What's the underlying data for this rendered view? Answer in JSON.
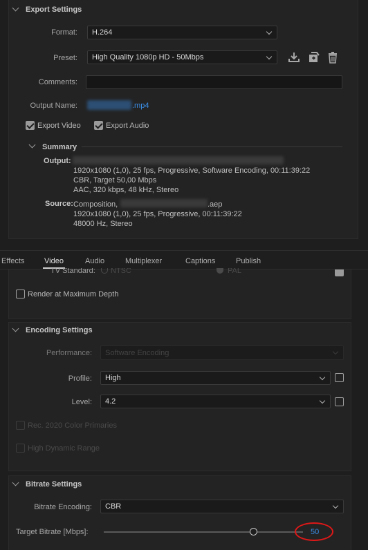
{
  "export_settings": {
    "title": "Export Settings",
    "format_label": "Format:",
    "format_value": "H.264",
    "preset_label": "Preset:",
    "preset_value": "High Quality 1080p HD - 50Mbps",
    "comments_label": "Comments:",
    "comments_value": "",
    "output_name_label": "Output Name:",
    "output_name_suffix": ".mp4",
    "export_video_label": "Export Video",
    "export_video_checked": true,
    "export_audio_label": "Export Audio",
    "export_audio_checked": true
  },
  "summary": {
    "title": "Summary",
    "output_label": "Output:",
    "output_lines": [
      "1920x1080 (1,0), 25 fps, Progressive, Software Encoding, 00:11:39:22",
      "CBR, Target 50,00 Mbps",
      "AAC, 320 kbps, 48 kHz, Stereo"
    ],
    "source_label": "Source:",
    "source_prefix": "Composition,",
    "source_suffix": ".aep",
    "source_lines": [
      "1920x1080 (1,0), 25 fps, Progressive, 00:11:39:22",
      "48000 Hz, Stereo"
    ]
  },
  "tabs": [
    "Effects",
    "Video",
    "Audio",
    "Multiplexer",
    "Captions",
    "Publish"
  ],
  "active_tab": "Video",
  "video": {
    "tv_standard_label": "TV Standard:",
    "ntsc_label": "NTSC",
    "pal_label": "PAL",
    "render_max_depth_label": "Render at Maximum Depth"
  },
  "encoding": {
    "title": "Encoding Settings",
    "performance_label": "Performance:",
    "performance_value": "Software Encoding",
    "profile_label": "Profile:",
    "profile_value": "High",
    "level_label": "Level:",
    "level_value": "4.2",
    "rec2020_label": "Rec. 2020 Color Primaries",
    "hdr_label": "High Dynamic Range"
  },
  "bitrate": {
    "title": "Bitrate Settings",
    "encoding_label": "Bitrate Encoding:",
    "encoding_value": "CBR",
    "target_label": "Target Bitrate [Mbps]:",
    "target_value": "50",
    "target_fraction": 0.75
  },
  "colors": {
    "link_blue": "#3a8ee6",
    "highlight_red": "#e01818"
  }
}
